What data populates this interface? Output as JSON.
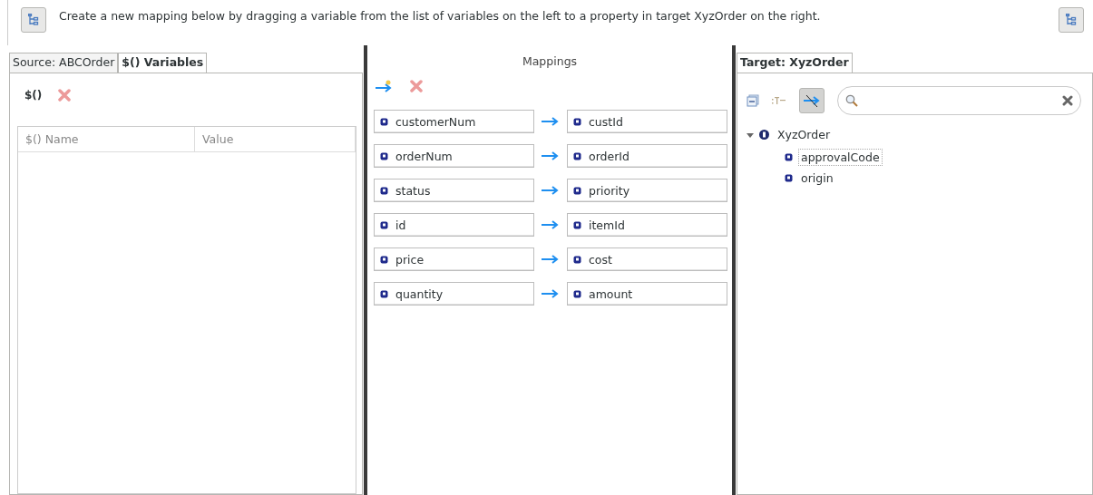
{
  "header": {
    "instruction": "Create a new mapping below by dragging a variable from the list of variables on the left to a property in target XyzOrder on the right."
  },
  "source": {
    "tabs": [
      {
        "label": "Source: ABCOrder",
        "selected": false
      },
      {
        "label": "$() Variables",
        "selected": true
      }
    ],
    "add_variable_icon": "$()",
    "columns": [
      "$() Name",
      "Value"
    ]
  },
  "mappings": {
    "title": "Mappings",
    "rows": [
      {
        "source": "customerNum",
        "target": "custId"
      },
      {
        "source": "orderNum",
        "target": "orderId"
      },
      {
        "source": "status",
        "target": "priority"
      },
      {
        "source": "id",
        "target": "itemId"
      },
      {
        "source": "price",
        "target": "cost"
      },
      {
        "source": "quantity",
        "target": "amount"
      }
    ]
  },
  "target": {
    "tabs": [
      {
        "label": "Target: XyzOrder",
        "selected": true
      }
    ],
    "filter_pressed": true,
    "tree": [
      {
        "label": "XyzOrder",
        "expanded": true,
        "selected": false,
        "children": [
          {
            "label": "approvalCode",
            "selected": true
          },
          {
            "label": "origin",
            "selected": false
          }
        ]
      }
    ]
  }
}
